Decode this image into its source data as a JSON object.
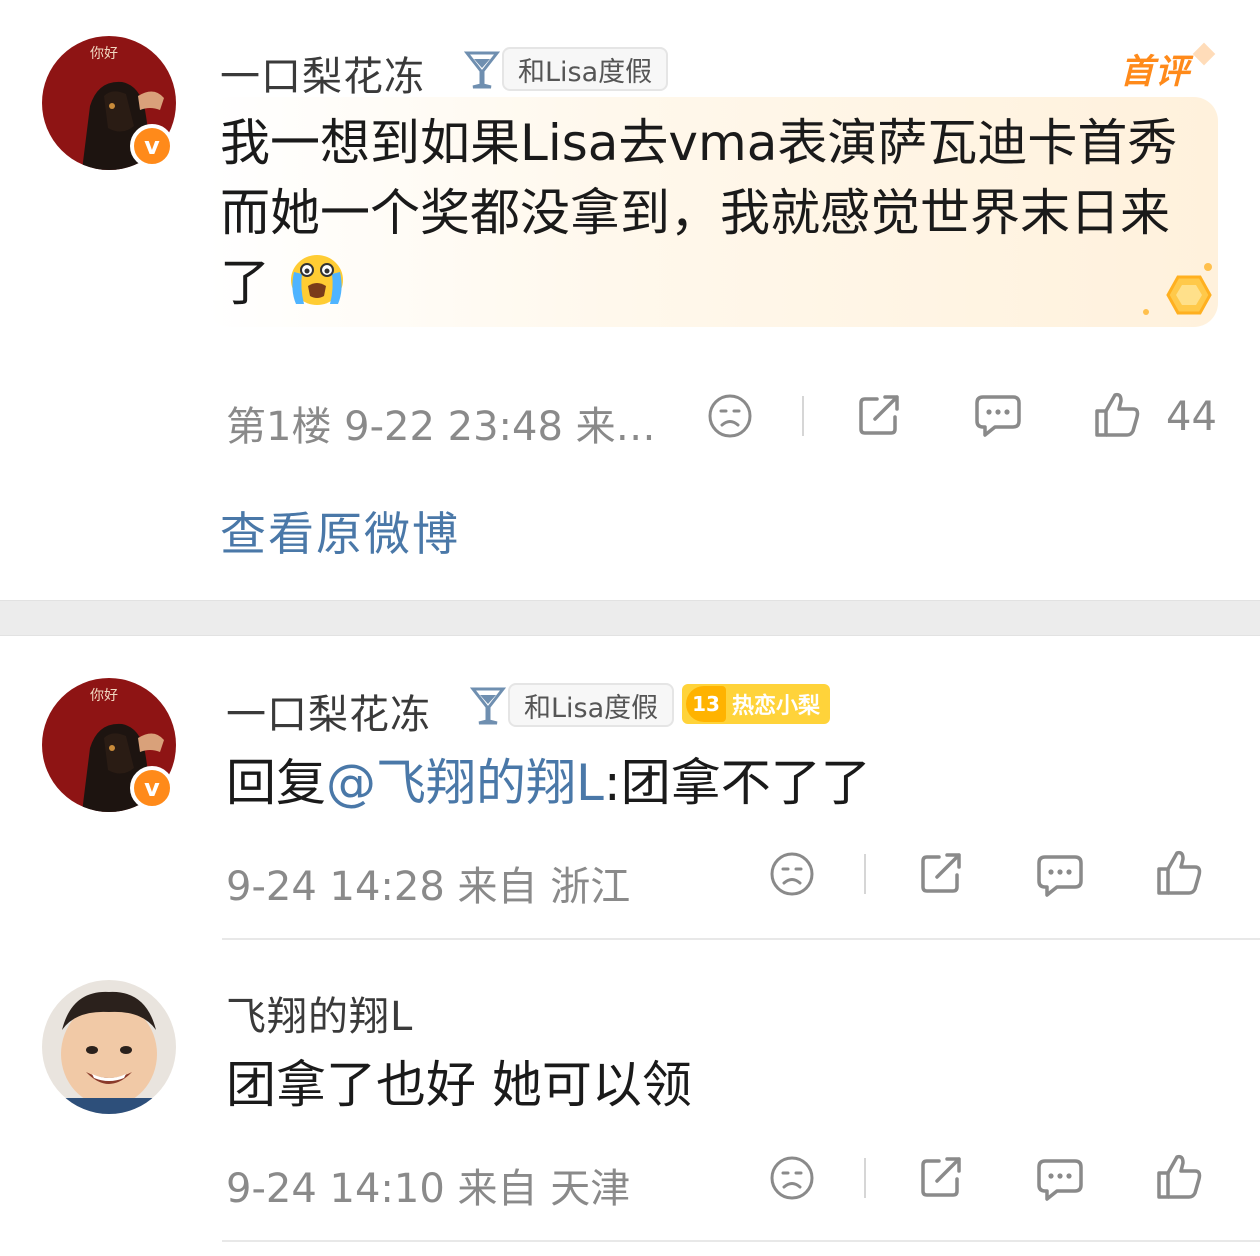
{
  "main_comment": {
    "username": "一口梨花冻",
    "tag_label": "和Lisa度假",
    "first_badge": "首评",
    "text": "我一想到如果Lisa去vma表演萨瓦迪卡首秀而她一个奖都没拿到，我就感觉世界末日来了",
    "emoji": "crying-face",
    "meta": "第1楼 9-22 23:48 来…",
    "like_count": "44",
    "view_original": "查看原微博"
  },
  "replies": [
    {
      "username": "一口梨花冻",
      "tag_label": "和Lisa度假",
      "fan_level": "13",
      "fan_badge": "热恋小梨",
      "reply_prefix": "回复",
      "mention": "@飞翔的翔L",
      "reply_text": ":团拿不了了",
      "meta": "9-24 14:28 来自 浙江"
    },
    {
      "username": "飞翔的翔L",
      "text": "团拿了也好 她可以领",
      "meta": "9-24 14:10 来自 天津"
    }
  ],
  "icons": {
    "frown": "frown-icon",
    "share": "share-icon",
    "comment": "comment-icon",
    "like": "thumbs-up-icon",
    "verified": "verified-v-icon",
    "glass": "cocktail-glass-icon"
  },
  "colors": {
    "accent_orange": "#ff8a1a",
    "link_blue": "#4a78a8",
    "meta_gray": "#8a8a8a",
    "fan_yellow": "#ffd33a"
  }
}
